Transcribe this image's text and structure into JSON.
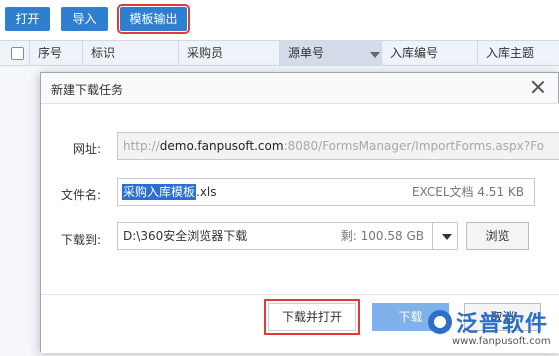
{
  "toolbar": {
    "open_label": "打开",
    "import_label": "导入",
    "export_template_label": "模板输出"
  },
  "grid": {
    "columns": [
      "序号",
      "标识",
      "采购员",
      "源单号",
      "入库编号",
      "入库主题"
    ]
  },
  "dialog": {
    "title": "新建下载任务",
    "url_label": "网址:",
    "url_prefix": "http://",
    "url_host": "demo.fanpusoft.com",
    "url_suffix": ":8080/FormsManager/ImportForms.aspx?Fo",
    "filename_label": "文件名:",
    "filename_selected": "采购入库模板",
    "filename_ext": ".xls",
    "file_type": "EXCEL文档",
    "file_size": "4.51 KB",
    "download_to_label": "下载到:",
    "download_path": "D:\\360安全浏览器下载",
    "free_space": "剩: 100.58 GB",
    "browse_label": "浏览",
    "download_open_label": "下载并打开",
    "download_label": "下载",
    "cancel_label": "取消"
  },
  "watermark": {
    "brand": "泛普软件",
    "url": "www.fanpusoft.com"
  },
  "colors": {
    "toolbar_button": "#2f7fd0",
    "highlight_outline": "#e03a3a",
    "selection": "#2a6fd1",
    "download_button": "#7fb2ea",
    "brand": "#2e6fc6"
  }
}
